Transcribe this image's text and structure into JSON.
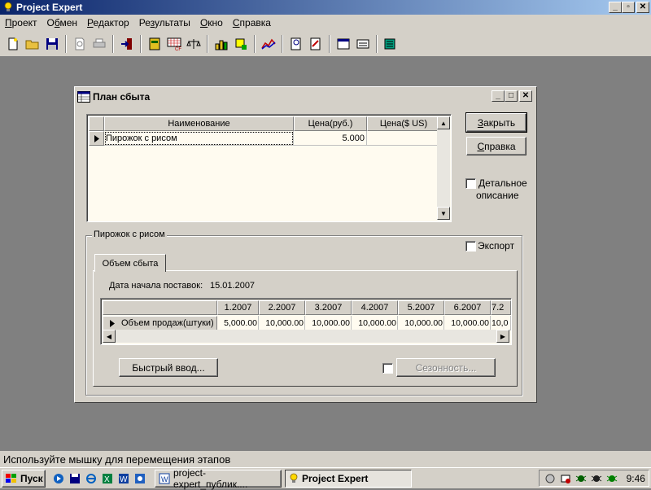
{
  "app": {
    "title": "Project Expert"
  },
  "menu": [
    {
      "label": "Проект",
      "accel": "П"
    },
    {
      "label": "Обмен",
      "accel": "б"
    },
    {
      "label": "Редактор",
      "accel": "Р"
    },
    {
      "label": "Результаты",
      "accel": "з"
    },
    {
      "label": "Окно",
      "accel": "О"
    },
    {
      "label": "Справка",
      "accel": "С"
    }
  ],
  "toolbar_icons": [
    "new-project-icon",
    "open-folder-icon",
    "save-disk-icon",
    "print-preview-icon",
    "print-icon",
    "exit-icon",
    "table-icon",
    "cashflow-icon",
    "balance-scales-icon",
    "chart-bars-icon",
    "highlight-icon",
    "line-chart-icon",
    "search-report-icon",
    "report-icon",
    "window-icon",
    "dialog-icon",
    "data-export-icon"
  ],
  "dialog": {
    "title": "План сбыта",
    "columns": {
      "name": "Наименование",
      "price_rub": "Цена(руб.)",
      "price_usd": "Цена($ US)"
    },
    "rows": [
      {
        "name": "Пирожок с рисом",
        "price_rub": "5.000",
        "price_usd": ""
      }
    ],
    "close_button": "Закрыть",
    "close_accel": "З",
    "help_button": "Справка",
    "help_accel": "С",
    "detail_checkbox": "Детальное описание",
    "detail_line1": "Детальное",
    "detail_line2": "описание",
    "group_title": "Пирожок с рисом",
    "export_checkbox": "Экспорт",
    "tab_label": "Объем сбыта",
    "start_date_label": "Дата начала поставок:",
    "start_date_value": "15.01.2007",
    "volume": {
      "months": [
        "1.2007",
        "2.2007",
        "3.2007",
        "4.2007",
        "5.2007",
        "6.2007",
        "7.2"
      ],
      "row_label": "Объем продаж(штуки)",
      "values": [
        "5,000.00",
        "10,000.00",
        "10,000.00",
        "10,000.00",
        "10,000.00",
        "10,000.00",
        "10,0"
      ]
    },
    "quick_input_button": "Быстрый ввод...",
    "seasonality_button": "Сезонность..."
  },
  "statusbar": {
    "text": "Используйте мышку для перемещения этапов"
  },
  "taskbar": {
    "start": "Пуск",
    "tasks": [
      {
        "label": "project-expert_публик....",
        "active": false
      },
      {
        "label": "Project Expert",
        "active": true
      }
    ],
    "clock": "9:46"
  }
}
